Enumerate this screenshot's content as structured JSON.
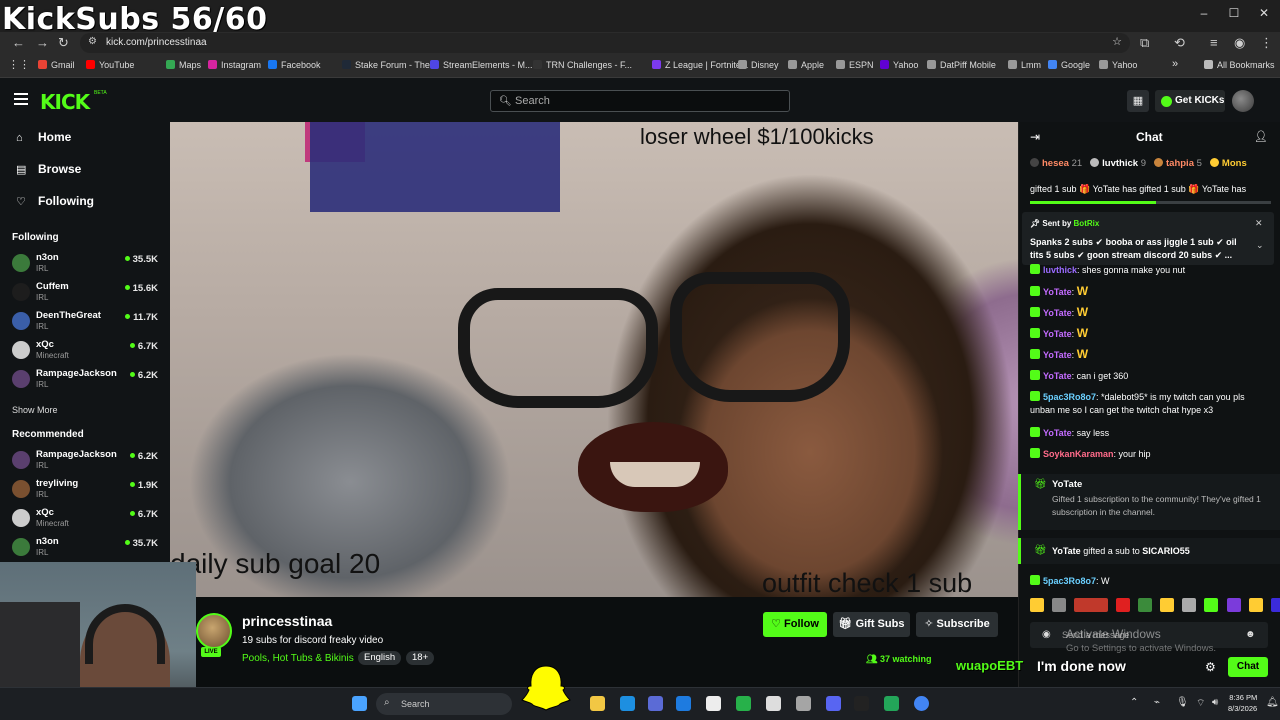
{
  "overlay": {
    "title": "KickSubs 56/60"
  },
  "browser": {
    "url": "kick.com/princesstinaa",
    "bookmarks": [
      {
        "label": "Gmail",
        "color": "#ea4335"
      },
      {
        "label": "YouTube",
        "color": "#ff0000"
      },
      {
        "label": "Maps",
        "color": "#34a853"
      },
      {
        "label": "Instagram",
        "color": "#d6249f"
      },
      {
        "label": "Facebook",
        "color": "#1877f2"
      },
      {
        "label": "Stake Forum - The...",
        "color": "#1f2937"
      },
      {
        "label": "StreamElements - M...",
        "color": "#4f46e5"
      },
      {
        "label": "TRN Challenges - F...",
        "color": "#333333"
      },
      {
        "label": "Z League | Fortnite...",
        "color": "#7c3aed"
      },
      {
        "label": "Disney",
        "color": "#999999"
      },
      {
        "label": "Apple",
        "color": "#999999"
      },
      {
        "label": "ESPN",
        "color": "#999999"
      },
      {
        "label": "Yahoo",
        "color": "#6001d2"
      },
      {
        "label": "DatPiff Mobile",
        "color": "#999999"
      },
      {
        "label": "Lmm",
        "color": "#999999"
      },
      {
        "label": "Google",
        "color": "#4285f4"
      },
      {
        "label": "Yahoo",
        "color": "#999999"
      }
    ],
    "all_bookmarks": "All Bookmarks"
  },
  "header": {
    "logo": "KICK",
    "beta": "BETA",
    "search_placeholder": "Search",
    "get_kicks": "Get KICKs"
  },
  "sidebar": {
    "nav": [
      {
        "label": "Home",
        "icon": "home-icon"
      },
      {
        "label": "Browse",
        "icon": "browse-icon"
      },
      {
        "label": "Following",
        "icon": "heart-icon"
      }
    ],
    "following_header": "Following",
    "following": [
      {
        "name": "n3on",
        "category": "IRL",
        "viewers": "35.5K",
        "color": "#3b7a3b"
      },
      {
        "name": "Cuffem",
        "category": "IRL",
        "viewers": "15.6K",
        "color": "#1d1d1d"
      },
      {
        "name": "DeenTheGreat",
        "category": "IRL",
        "viewers": "11.7K",
        "color": "#3a5ea8"
      },
      {
        "name": "xQc",
        "category": "Minecraft",
        "viewers": "6.7K",
        "color": "#cccccc"
      },
      {
        "name": "RampageJackson",
        "category": "IRL",
        "viewers": "6.2K",
        "color": "#5a3f6e"
      }
    ],
    "show_more": "Show More",
    "recommended_header": "Recommended",
    "recommended": [
      {
        "name": "RampageJackson",
        "category": "IRL",
        "viewers": "6.2K",
        "color": "#5a3f6e"
      },
      {
        "name": "treyliving",
        "category": "IRL",
        "viewers": "1.9K",
        "color": "#7a5030"
      },
      {
        "name": "xQc",
        "category": "Minecraft",
        "viewers": "6.7K",
        "color": "#cccccc"
      },
      {
        "name": "n3on",
        "category": "IRL",
        "viewers": "35.7K",
        "color": "#3b7a3b"
      }
    ]
  },
  "video": {
    "text_top": "loser wheel $1/100kicks",
    "text_left": "daily sub goal 20",
    "text_right": "outfit check 1 sub"
  },
  "stream": {
    "streamer": "princesstinaa",
    "live": "LIVE",
    "title": "19 subs for discord freaky video",
    "category": "Pools, Hot Tubs & Bikinis",
    "tags": [
      "English",
      "18+"
    ],
    "follow": "Follow",
    "gift_subs": "Gift Subs",
    "subscribe": "Subscribe",
    "watching": "37 watching"
  },
  "chat": {
    "title": "Chat",
    "leaderboard": [
      {
        "name": "hesea",
        "count": "21",
        "color": "#ff8a65",
        "badge": "#444"
      },
      {
        "name": "luvthick",
        "count": "9",
        "color": "#ffffff",
        "badge": "#bbbbbb"
      },
      {
        "name": "tahpia",
        "count": "5",
        "color": "#ff8a65",
        "badge": "#c8843c"
      },
      {
        "name": "Mons",
        "count": "",
        "color": "#ffcc33",
        "badge": "#ffcc33"
      }
    ],
    "gifted_marquee": "gifted 1 sub  🎁 YoTate has gifted 1 sub  🎁 YoTate has",
    "pinned_from_prefix": "Sent by",
    "pinned_from_user": "BotRix",
    "pinned_text": "Spanks 2 subs ✔ booba or ass jiggle 1 sub ✔ oil tits 5 subs ✔ goon stream discord 20 subs ✔ ...",
    "messages": [
      {
        "user": "luvthick",
        "color": "#9b6bff",
        "text": ": shes gonna make you nut",
        "w": false
      },
      {
        "user": "YoTate",
        "color": "#c36bff",
        "text": ":",
        "w": true
      },
      {
        "user": "YoTate",
        "color": "#c36bff",
        "text": ":",
        "w": true
      },
      {
        "user": "YoTate",
        "color": "#c36bff",
        "text": ":",
        "w": true
      },
      {
        "user": "YoTate",
        "color": "#c36bff",
        "text": ":",
        "w": true
      },
      {
        "user": "YoTate",
        "color": "#c36bff",
        "text": ": can i get 360",
        "w": false
      },
      {
        "user": "5pac3Ro8o7",
        "color": "#6bd0ff",
        "text": ": *dalebot95* is my twitch can you pls unban me so I can get the twitch chat hype x3",
        "w": false
      },
      {
        "user": "YoTate",
        "color": "#c36bff",
        "text": ": say less",
        "w": false
      },
      {
        "user": "SoykanKaraman",
        "color": "#ff6b8a",
        "text": ": your hip",
        "w": false
      }
    ],
    "w_emote": "W",
    "sub_user": "YoTate",
    "sub_text": "Gifted 1 subscription to the community! They've gifted 1 subscription in the channel.",
    "gift_user": "YoTate",
    "gift_mid": "gifted a sub to",
    "gift_target": "SICARIO55",
    "last_msg_user": "5pac3Ro8o7",
    "last_msg_text": ": W",
    "input_placeholder": "Send a message",
    "chat_button": "Chat",
    "activate_1": "Activate Windows",
    "activate_2": "Go to Settings to activate Windows.",
    "done_now": "I'm done now",
    "overlay_user": "wuapoEBT"
  },
  "taskbar": {
    "search": "Search",
    "time": "8:36 PM",
    "date": "8/3/2026"
  }
}
